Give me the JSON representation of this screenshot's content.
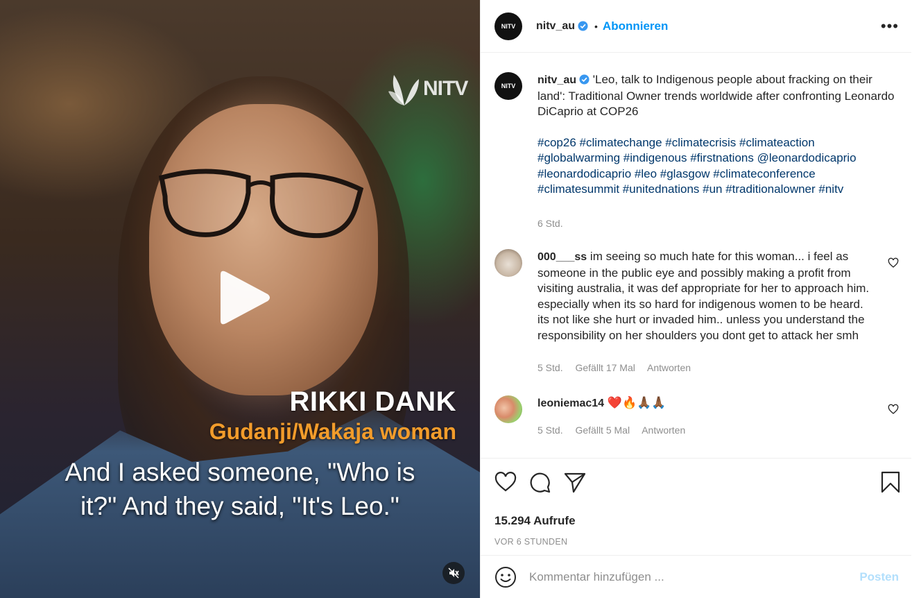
{
  "media": {
    "watermark": "NITV",
    "name": "RIKKI DANK",
    "subtitle_role": "Gudanji/Wakaja woman",
    "caption_lines": [
      "And I asked someone, \"Who is",
      "it?\" And they said, \"It's Leo.\""
    ]
  },
  "header": {
    "avatar_text": "NITV",
    "username": "nitv_au",
    "separator": "•",
    "follow_label": "Abonnieren",
    "more_label": "•••"
  },
  "post_caption": {
    "username": "nitv_au",
    "text": "'Leo, talk to Indigenous people about fracking on their land': Traditional Owner trends worldwide after confronting Leonardo DiCaprio at COP26",
    "hashtags": "#cop26 #climatechange #climatecrisis #climateaction #globalwarming #indigenous #firstnations @leonardodicaprio #leonardodicaprio #leo #glasgow #climateconference #climatesummit #unitednations #un #traditionalowner #nitv",
    "time": "6 Std."
  },
  "comments": [
    {
      "username": "000___ss",
      "text": "im seeing so much hate for this woman... i feel as someone in the public eye and possibly making a profit from visiting australia, it was def appropriate for her to approach him. especially when its so hard for indigenous women to be heard. its not like she hurt or invaded him.. unless you understand the responsibility on her shoulders you dont get to attack her smh",
      "time": "5 Std.",
      "likes": "Gefällt 17 Mal",
      "reply": "Antworten"
    },
    {
      "username": "leoniemac14",
      "text": "❤️🔥🙏🏾🙏🏾",
      "time": "5 Std.",
      "likes": "Gefällt 5 Mal",
      "reply": "Antworten"
    }
  ],
  "stats": {
    "views": "15.294 Aufrufe",
    "ago": "VOR 6 STUNDEN"
  },
  "add_comment": {
    "placeholder": "Kommentar hinzufügen ...",
    "post_label": "Posten"
  },
  "icons": [
    "play-icon",
    "mute-icon",
    "verified-badge-icon",
    "more-icon",
    "heart-icon",
    "comment-icon",
    "share-icon",
    "bookmark-icon",
    "emoji-icon"
  ],
  "colors": {
    "accent": "#0095f6",
    "name_tag_orange": "#f29c2b",
    "tag_link": "#00376b",
    "muted": "#8e8e8e"
  }
}
